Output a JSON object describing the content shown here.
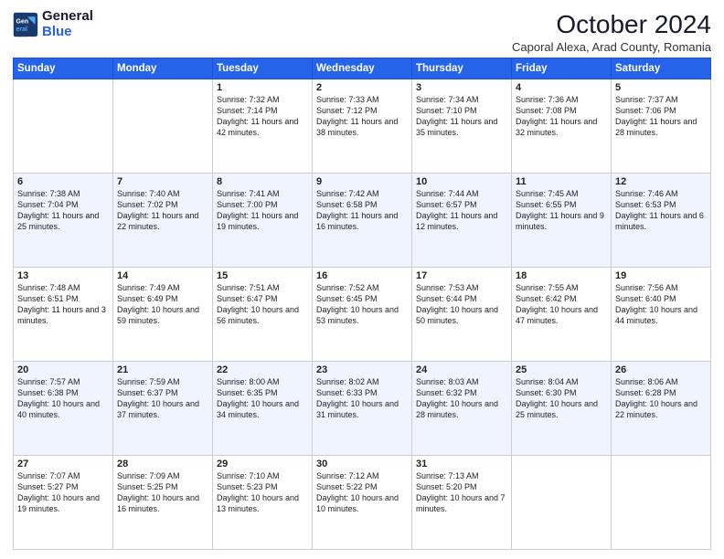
{
  "logo": {
    "line1": "General",
    "line2": "Blue"
  },
  "title": "October 2024",
  "subtitle": "Caporal Alexa, Arad County, Romania",
  "weekdays": [
    "Sunday",
    "Monday",
    "Tuesday",
    "Wednesday",
    "Thursday",
    "Friday",
    "Saturday"
  ],
  "weeks": [
    [
      {
        "day": "",
        "text": ""
      },
      {
        "day": "",
        "text": ""
      },
      {
        "day": "1",
        "text": "Sunrise: 7:32 AM\nSunset: 7:14 PM\nDaylight: 11 hours and 42 minutes."
      },
      {
        "day": "2",
        "text": "Sunrise: 7:33 AM\nSunset: 7:12 PM\nDaylight: 11 hours and 38 minutes."
      },
      {
        "day": "3",
        "text": "Sunrise: 7:34 AM\nSunset: 7:10 PM\nDaylight: 11 hours and 35 minutes."
      },
      {
        "day": "4",
        "text": "Sunrise: 7:36 AM\nSunset: 7:08 PM\nDaylight: 11 hours and 32 minutes."
      },
      {
        "day": "5",
        "text": "Sunrise: 7:37 AM\nSunset: 7:06 PM\nDaylight: 11 hours and 28 minutes."
      }
    ],
    [
      {
        "day": "6",
        "text": "Sunrise: 7:38 AM\nSunset: 7:04 PM\nDaylight: 11 hours and 25 minutes."
      },
      {
        "day": "7",
        "text": "Sunrise: 7:40 AM\nSunset: 7:02 PM\nDaylight: 11 hours and 22 minutes."
      },
      {
        "day": "8",
        "text": "Sunrise: 7:41 AM\nSunset: 7:00 PM\nDaylight: 11 hours and 19 minutes."
      },
      {
        "day": "9",
        "text": "Sunrise: 7:42 AM\nSunset: 6:58 PM\nDaylight: 11 hours and 16 minutes."
      },
      {
        "day": "10",
        "text": "Sunrise: 7:44 AM\nSunset: 6:57 PM\nDaylight: 11 hours and 12 minutes."
      },
      {
        "day": "11",
        "text": "Sunrise: 7:45 AM\nSunset: 6:55 PM\nDaylight: 11 hours and 9 minutes."
      },
      {
        "day": "12",
        "text": "Sunrise: 7:46 AM\nSunset: 6:53 PM\nDaylight: 11 hours and 6 minutes."
      }
    ],
    [
      {
        "day": "13",
        "text": "Sunrise: 7:48 AM\nSunset: 6:51 PM\nDaylight: 11 hours and 3 minutes."
      },
      {
        "day": "14",
        "text": "Sunrise: 7:49 AM\nSunset: 6:49 PM\nDaylight: 10 hours and 59 minutes."
      },
      {
        "day": "15",
        "text": "Sunrise: 7:51 AM\nSunset: 6:47 PM\nDaylight: 10 hours and 56 minutes."
      },
      {
        "day": "16",
        "text": "Sunrise: 7:52 AM\nSunset: 6:45 PM\nDaylight: 10 hours and 53 minutes."
      },
      {
        "day": "17",
        "text": "Sunrise: 7:53 AM\nSunset: 6:44 PM\nDaylight: 10 hours and 50 minutes."
      },
      {
        "day": "18",
        "text": "Sunrise: 7:55 AM\nSunset: 6:42 PM\nDaylight: 10 hours and 47 minutes."
      },
      {
        "day": "19",
        "text": "Sunrise: 7:56 AM\nSunset: 6:40 PM\nDaylight: 10 hours and 44 minutes."
      }
    ],
    [
      {
        "day": "20",
        "text": "Sunrise: 7:57 AM\nSunset: 6:38 PM\nDaylight: 10 hours and 40 minutes."
      },
      {
        "day": "21",
        "text": "Sunrise: 7:59 AM\nSunset: 6:37 PM\nDaylight: 10 hours and 37 minutes."
      },
      {
        "day": "22",
        "text": "Sunrise: 8:00 AM\nSunset: 6:35 PM\nDaylight: 10 hours and 34 minutes."
      },
      {
        "day": "23",
        "text": "Sunrise: 8:02 AM\nSunset: 6:33 PM\nDaylight: 10 hours and 31 minutes."
      },
      {
        "day": "24",
        "text": "Sunrise: 8:03 AM\nSunset: 6:32 PM\nDaylight: 10 hours and 28 minutes."
      },
      {
        "day": "25",
        "text": "Sunrise: 8:04 AM\nSunset: 6:30 PM\nDaylight: 10 hours and 25 minutes."
      },
      {
        "day": "26",
        "text": "Sunrise: 8:06 AM\nSunset: 6:28 PM\nDaylight: 10 hours and 22 minutes."
      }
    ],
    [
      {
        "day": "27",
        "text": "Sunrise: 7:07 AM\nSunset: 5:27 PM\nDaylight: 10 hours and 19 minutes."
      },
      {
        "day": "28",
        "text": "Sunrise: 7:09 AM\nSunset: 5:25 PM\nDaylight: 10 hours and 16 minutes."
      },
      {
        "day": "29",
        "text": "Sunrise: 7:10 AM\nSunset: 5:23 PM\nDaylight: 10 hours and 13 minutes."
      },
      {
        "day": "30",
        "text": "Sunrise: 7:12 AM\nSunset: 5:22 PM\nDaylight: 10 hours and 10 minutes."
      },
      {
        "day": "31",
        "text": "Sunrise: 7:13 AM\nSunset: 5:20 PM\nDaylight: 10 hours and 7 minutes."
      },
      {
        "day": "",
        "text": ""
      },
      {
        "day": "",
        "text": ""
      }
    ]
  ]
}
